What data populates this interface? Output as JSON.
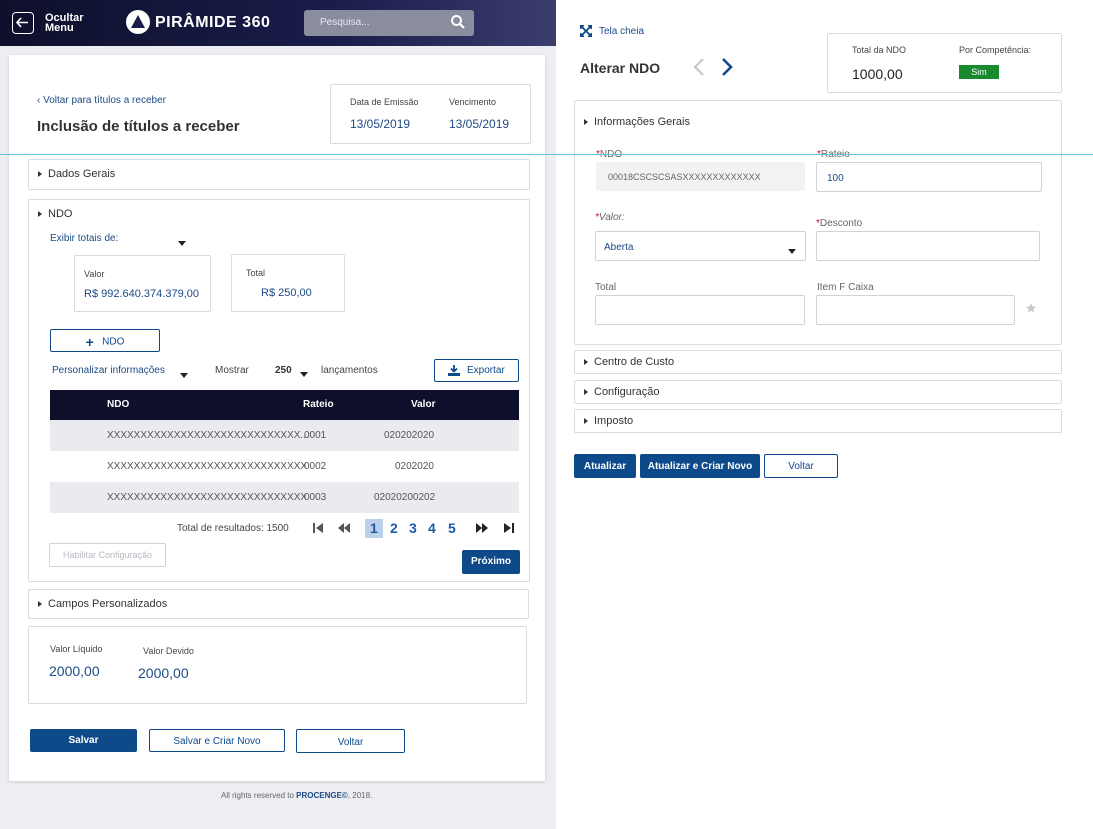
{
  "header": {
    "menu_label_1": "Ocultar",
    "menu_label_2": "Menu",
    "logo": "PIRÂMIDE 360",
    "search_placeholder": "Pesquisa..."
  },
  "left": {
    "back_link": "Voltar para títulos a receber",
    "title": "Inclusão de títulos a receber",
    "emission_label": "Data de Emissão",
    "emission_value": "13/05/2019",
    "due_label": "Vencimento",
    "due_value": "13/05/2019",
    "section_general": "Dados Gerais",
    "section_ndo": "NDO",
    "totals_label": "Exibir totais de:",
    "valor_label": "Valor",
    "valor_value": "R$ 992.640.374.379,00",
    "total_label": "Total",
    "total_value": "R$ 250,00",
    "add_ndo": "NDO",
    "customize": "Personalizar informações",
    "show": "Mostrar",
    "show_count": "250",
    "entries": "lançamentos",
    "export": "Exportar",
    "table": {
      "headers": [
        "NDO",
        "Rateio",
        "Valor"
      ],
      "rows": [
        [
          "XXXXXXXXXXXXXXXXXXXXXXXXXXXXX...",
          "0001",
          "020202020"
        ],
        [
          "XXXXXXXXXXXXXXXXXXXXXXXXXXXXXX",
          "0002",
          "0202020"
        ],
        [
          "XXXXXXXXXXXXXXXXXXXXXXXXXXXXXX",
          "0003",
          "02020200202"
        ]
      ]
    },
    "results": "Total de resultados: 1500",
    "pages": [
      "1",
      "2",
      "3",
      "4",
      "5"
    ],
    "enable_config": "Habilitar Configuração",
    "next": "Próximo",
    "section_custom": "Campos Personalizados",
    "net_label": "Valor Líquido",
    "net_value": "2000,00",
    "owed_label": "Valor Devido",
    "owed_value": "2000,00",
    "save": "Salvar",
    "save_new": "Salvar e Criar Novo",
    "back": "Voltar",
    "footer_pre": "All rights reserved to ",
    "footer_brand": "PROCENGE©",
    "footer_post": ", 2018."
  },
  "right": {
    "fullscreen": "Tela cheia",
    "title": "Alterar NDO",
    "total_ndo_label": "Total da NDO",
    "total_ndo_value": "1000,00",
    "competence_label": "Por Competência:",
    "competence_value": "Sim",
    "section_info": "Informações Gerais",
    "ndo_label": "NDO",
    "ndo_value": "00018CSCSCSASXXXXXXXXXXXXX",
    "rateio_label": "Rateio",
    "rateio_value": "100",
    "valor_label": "Valor:",
    "valor_value": "Aberta",
    "desconto_label": "Desconto",
    "total_label": "Total",
    "item_label": "Item F Caixa",
    "section_cost": "Centro de Custo",
    "section_config": "Configuração",
    "section_tax": "Imposto",
    "update": "Atualizar",
    "update_new": "Atualizar e Criar Novo",
    "back": "Voltar"
  },
  "colors": {
    "primary": "#0e4a8a",
    "dark": "#0d0f2b",
    "success": "#1a8a2e",
    "required": "#d0021b"
  }
}
